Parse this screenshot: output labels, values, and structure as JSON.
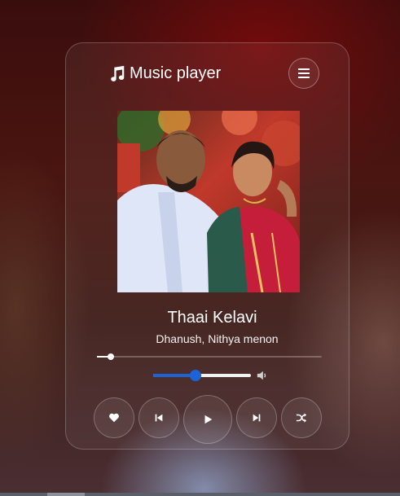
{
  "app": {
    "title": "Music player",
    "icon": "music-note-icon",
    "menu_icon": "hamburger-menu-icon"
  },
  "track": {
    "title": "Thaai Kelavi",
    "artist": "Dhanush, Nithya menon",
    "cover_art": "album-cover-image"
  },
  "playback": {
    "progress_fraction": 0.06,
    "volume_fraction": 0.43
  },
  "controls": [
    {
      "name": "like",
      "icon": "heart-icon"
    },
    {
      "name": "previous",
      "icon": "skip-previous-icon"
    },
    {
      "name": "play",
      "icon": "play-icon"
    },
    {
      "name": "next",
      "icon": "skip-next-icon"
    },
    {
      "name": "shuffle",
      "icon": "shuffle-icon"
    }
  ],
  "colors": {
    "accent": "#1e63d6",
    "text": "#ffffff"
  }
}
